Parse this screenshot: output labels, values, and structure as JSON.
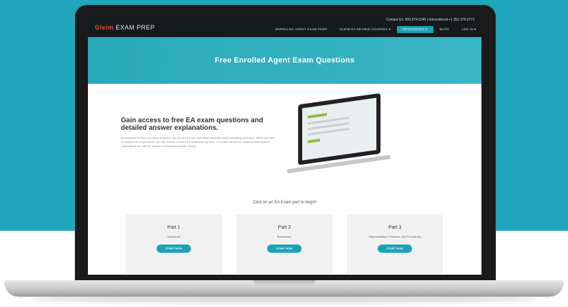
{
  "colors": {
    "background_accent": "#1fa6bd",
    "hero": "#2aa9b9",
    "button": "#1aa3b8"
  },
  "site": {
    "logo_brand": "Gleim",
    "logo_rest": "EXAM PREP",
    "contact": "Contact Us: 800.874.5346 | International +1 352.375.0772",
    "nav": {
      "items": [
        {
          "label": "ENROLLED AGENT EXAM PREP",
          "active": false
        },
        {
          "label": "GLEIM EA REVIEW COURSES ▾",
          "active": false
        },
        {
          "label": "RESOURCES ▾",
          "active": true
        },
        {
          "label": "BLOG",
          "active": false
        },
        {
          "label": "LOG IN ▾",
          "active": false
        }
      ],
      "cart_icon": "cart-icon",
      "search_icon": "search-icon"
    },
    "hero_title": "Free Enrolled Agent Exam Questions",
    "headline": "Gain access to free EA exam questions and detailed answer explanations.",
    "paragraph": "Be prepared for how you will be tested on the actual EA Exam with these authentic exam simulating questions. When you have completed the 20 questions, you will receive a score as a breakdown by topic. You'll also be able to review detailed answer explanations for both the correct and incorrect answer choices.",
    "cta": "Click on an EA Exam part to begin!",
    "cards": [
      {
        "part": "Part 1",
        "subtitle": "Individuals",
        "button": "START NOW"
      },
      {
        "part": "Part 2",
        "subtitle": "Businesses",
        "button": "START NOW"
      },
      {
        "part": "Part 3",
        "subtitle": "Representation, Practices, and Procedures",
        "button": "START NOW"
      }
    ]
  }
}
